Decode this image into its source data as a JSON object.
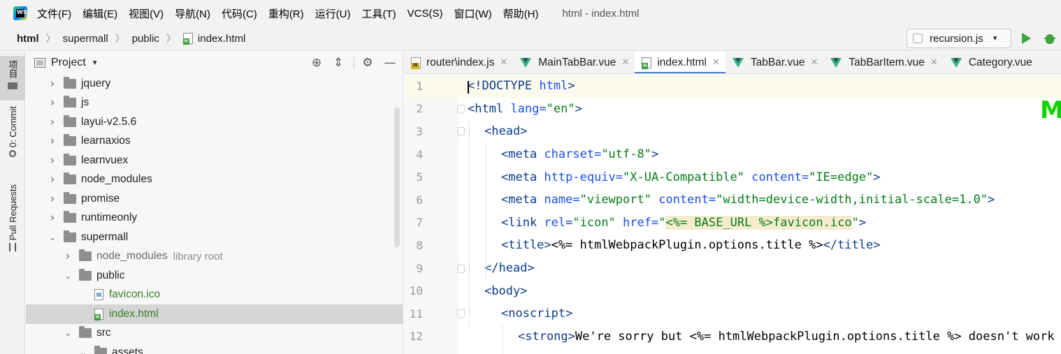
{
  "app": {
    "logo_text": "WS",
    "window_title": "html - index.html"
  },
  "menu": [
    "文件(F)",
    "编辑(E)",
    "视图(V)",
    "导航(N)",
    "代码(C)",
    "重构(R)",
    "运行(U)",
    "工具(T)",
    "VCS(S)",
    "窗口(W)",
    "帮助(H)"
  ],
  "breadcrumb": [
    "html",
    "supermall",
    "public",
    "index.html"
  ],
  "run_config": {
    "label": "recursion.js"
  },
  "tool_stripe": {
    "project": "项目",
    "commit": "0: Commit",
    "pull_requests": "Pull Requests"
  },
  "project_panel": {
    "title": "Project",
    "tree": [
      {
        "label": "jquery",
        "type": "folder",
        "depth": 0,
        "expanded": false
      },
      {
        "label": "js",
        "type": "folder",
        "depth": 0,
        "expanded": false
      },
      {
        "label": "layui-v2.5.6",
        "type": "folder",
        "depth": 0,
        "expanded": false
      },
      {
        "label": "learnaxios",
        "type": "folder",
        "depth": 0,
        "expanded": false
      },
      {
        "label": "learnvuex",
        "type": "folder",
        "depth": 0,
        "expanded": false
      },
      {
        "label": "node_modules",
        "type": "folder",
        "depth": 0,
        "expanded": false
      },
      {
        "label": "promise",
        "type": "folder",
        "depth": 0,
        "expanded": false
      },
      {
        "label": "runtimeonly",
        "type": "folder",
        "depth": 0,
        "expanded": false
      },
      {
        "label": "supermall",
        "type": "folder",
        "depth": 0,
        "expanded": true
      },
      {
        "label": "node_modules",
        "type": "folder",
        "depth": 1,
        "expanded": false,
        "suffix": "library root"
      },
      {
        "label": "public",
        "type": "folder",
        "depth": 1,
        "expanded": true
      },
      {
        "label": "favicon.ico",
        "type": "ico",
        "depth": 2
      },
      {
        "label": "index.html",
        "type": "html",
        "depth": 2,
        "selected": true
      },
      {
        "label": "src",
        "type": "folder",
        "depth": 1,
        "expanded": true
      },
      {
        "label": "assets",
        "type": "folder",
        "depth": 2,
        "expanded": true
      }
    ]
  },
  "tabs": [
    {
      "label": "router\\index.js",
      "type": "js",
      "closable": true
    },
    {
      "label": "MainTabBar.vue",
      "type": "vue",
      "closable": true
    },
    {
      "label": "index.html",
      "type": "html",
      "closable": true,
      "active": true
    },
    {
      "label": "TabBar.vue",
      "type": "vue",
      "closable": true
    },
    {
      "label": "TabBarItem.vue",
      "type": "vue",
      "closable": true
    },
    {
      "label": "Category.vue",
      "type": "vue",
      "closable": false
    }
  ],
  "editor": {
    "inspection_mark": "M",
    "lines": [
      {
        "n": "1",
        "indent": 0,
        "tokens": [
          [
            "tag",
            "<!DOCTYPE "
          ],
          [
            "attr",
            "html"
          ],
          [
            "tag",
            ">"
          ]
        ]
      },
      {
        "n": "2",
        "indent": 0,
        "tokens": [
          [
            "tag",
            "<html "
          ],
          [
            "attr",
            "lang="
          ],
          [
            "val",
            "\"en\""
          ],
          [
            "tag",
            ">"
          ]
        ]
      },
      {
        "n": "3",
        "indent": 1,
        "tokens": [
          [
            "tag",
            "<head>"
          ]
        ]
      },
      {
        "n": "4",
        "indent": 2,
        "tokens": [
          [
            "tag",
            "<meta "
          ],
          [
            "attr",
            "charset="
          ],
          [
            "val",
            "\"utf-8\""
          ],
          [
            "tag",
            ">"
          ]
        ]
      },
      {
        "n": "5",
        "indent": 2,
        "tokens": [
          [
            "tag",
            "<meta "
          ],
          [
            "attr",
            "http-equiv="
          ],
          [
            "val",
            "\"X-UA-Compatible\""
          ],
          [
            "plain",
            " "
          ],
          [
            "attr",
            "content="
          ],
          [
            "val",
            "\"IE=edge\""
          ],
          [
            "tag",
            ">"
          ]
        ]
      },
      {
        "n": "6",
        "indent": 2,
        "tokens": [
          [
            "tag",
            "<meta "
          ],
          [
            "attr",
            "name="
          ],
          [
            "val",
            "\"viewport\""
          ],
          [
            "plain",
            " "
          ],
          [
            "attr",
            "content="
          ],
          [
            "val",
            "\"width=device-width,initial-scale=1.0\""
          ],
          [
            "tag",
            ">"
          ]
        ]
      },
      {
        "n": "7",
        "indent": 2,
        "tokens": [
          [
            "tag",
            "<link "
          ],
          [
            "attr",
            "rel="
          ],
          [
            "val",
            "\"icon\""
          ],
          [
            "plain",
            " "
          ],
          [
            "attr",
            "href="
          ],
          [
            "val",
            "\""
          ],
          [
            "tplval",
            "<%= BASE_URL %>favicon.ico"
          ],
          [
            "val",
            "\""
          ],
          [
            "tag",
            ">"
          ]
        ]
      },
      {
        "n": "8",
        "indent": 2,
        "tokens": [
          [
            "tag",
            "<title>"
          ],
          [
            "plain",
            "<%= htmlWebpackPlugin.options.title %>"
          ],
          [
            "tag",
            "</title>"
          ]
        ]
      },
      {
        "n": "9",
        "indent": 1,
        "tokens": [
          [
            "tag",
            "</head>"
          ]
        ]
      },
      {
        "n": "10",
        "indent": 1,
        "tokens": [
          [
            "tag",
            "<body>"
          ]
        ]
      },
      {
        "n": "11",
        "indent": 2,
        "tokens": [
          [
            "tag",
            "<noscript>"
          ]
        ]
      },
      {
        "n": "12",
        "indent": 3,
        "tokens": [
          [
            "tag",
            "<strong>"
          ],
          [
            "plain",
            "We're sorry but <%= htmlWebpackPlugin.options.title %> doesn't work properly without JavaScript enabled. Please enable it to continue."
          ],
          [
            "tag",
            "</strong>"
          ]
        ]
      }
    ]
  }
}
